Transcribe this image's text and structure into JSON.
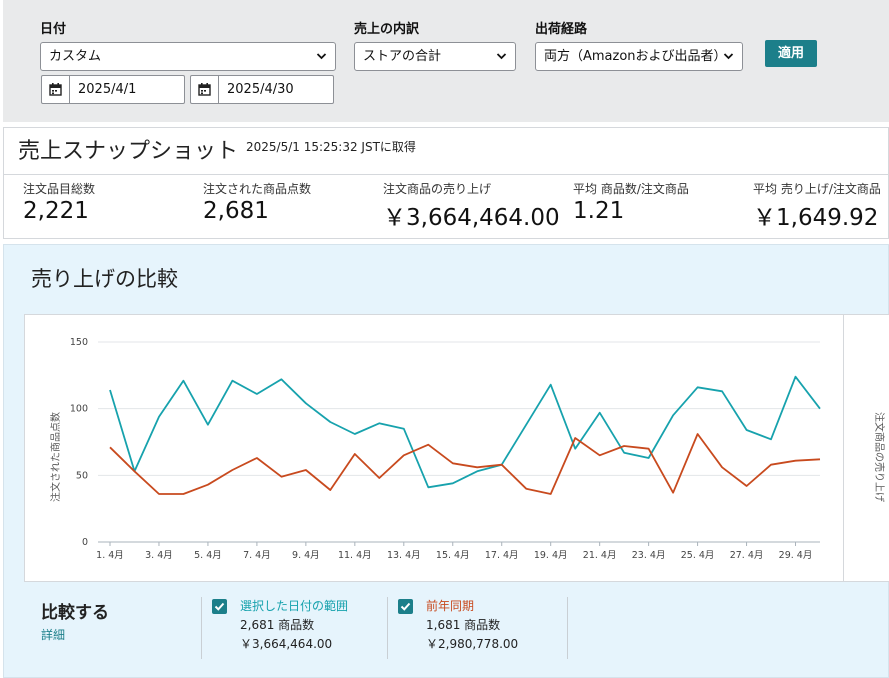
{
  "filters": {
    "date_label": "日付",
    "date_select": "カスタム",
    "start_date": "2025/4/1",
    "end_date": "2025/4/30",
    "breakdown_label": "売上の内訳",
    "breakdown_select": "ストアの合計",
    "channel_label": "出荷経路",
    "channel_select": "両方（Amazonおよび出品者）",
    "apply_label": "適用"
  },
  "snapshot": {
    "title": "売上スナップショット",
    "timestamp": "2025/5/1 15:25:32 JSTに取得",
    "metrics": [
      {
        "label": "注文品目総数",
        "value": "2,221"
      },
      {
        "label": "注文された商品点数",
        "value": "2,681"
      },
      {
        "label": "注文商品の売り上げ",
        "value": "￥3,664,464.00"
      },
      {
        "label": "平均 商品数/注文商品",
        "value": "1.21"
      },
      {
        "label": "平均 売り上げ/注文商品",
        "value": "￥1,649.92"
      }
    ]
  },
  "compare": {
    "title": "売り上げの比較",
    "legend_title": "比較する",
    "detail_link": "詳細",
    "items": [
      {
        "name": "選択した日付の範囲",
        "units": "2,681 商品数",
        "sales": "￥3,664,464.00",
        "color": "#17a2ad"
      },
      {
        "name": "前年同期",
        "units": "1,681 商品数",
        "sales": "￥2,980,778.00",
        "color": "#c84a1e"
      }
    ]
  },
  "chart_data": {
    "type": "line",
    "ylabel_left": "注文された商品点数",
    "ylabel_right": "注文商品の売り上げ",
    "yticks": [
      0,
      50,
      100,
      150
    ],
    "ylim": [
      0,
      150
    ],
    "x": [
      "1",
      "2",
      "3",
      "4",
      "5",
      "6",
      "7",
      "8",
      "9",
      "10",
      "11",
      "12",
      "13",
      "14",
      "15",
      "16",
      "17",
      "18",
      "19",
      "20",
      "21",
      "22",
      "23",
      "24",
      "25",
      "26",
      "27",
      "28",
      "29",
      "30"
    ],
    "xtick_labels": [
      "1. 4月",
      "3. 4月",
      "5. 4月",
      "7. 4月",
      "9. 4月",
      "11. 4月",
      "13. 4月",
      "15. 4月",
      "17. 4月",
      "19. 4月",
      "21. 4月",
      "23. 4月",
      "25. 4月",
      "27. 4月",
      "29. 4月"
    ],
    "series": [
      {
        "name": "選択した日付の範囲",
        "color": "#17a2ad",
        "values": [
          114,
          53,
          94,
          121,
          88,
          121,
          111,
          122,
          104,
          90,
          81,
          89,
          85,
          41,
          44,
          53,
          58,
          88,
          118,
          70,
          97,
          67,
          63,
          95,
          116,
          113,
          84,
          77,
          124,
          100
        ]
      },
      {
        "name": "前年同期",
        "color": "#c84a1e",
        "values": [
          71,
          53,
          36,
          36,
          43,
          54,
          63,
          49,
          54,
          39,
          66,
          48,
          65,
          73,
          59,
          56,
          58,
          40,
          36,
          78,
          65,
          72,
          70,
          37,
          81,
          56,
          42,
          58,
          61,
          62
        ]
      }
    ]
  }
}
